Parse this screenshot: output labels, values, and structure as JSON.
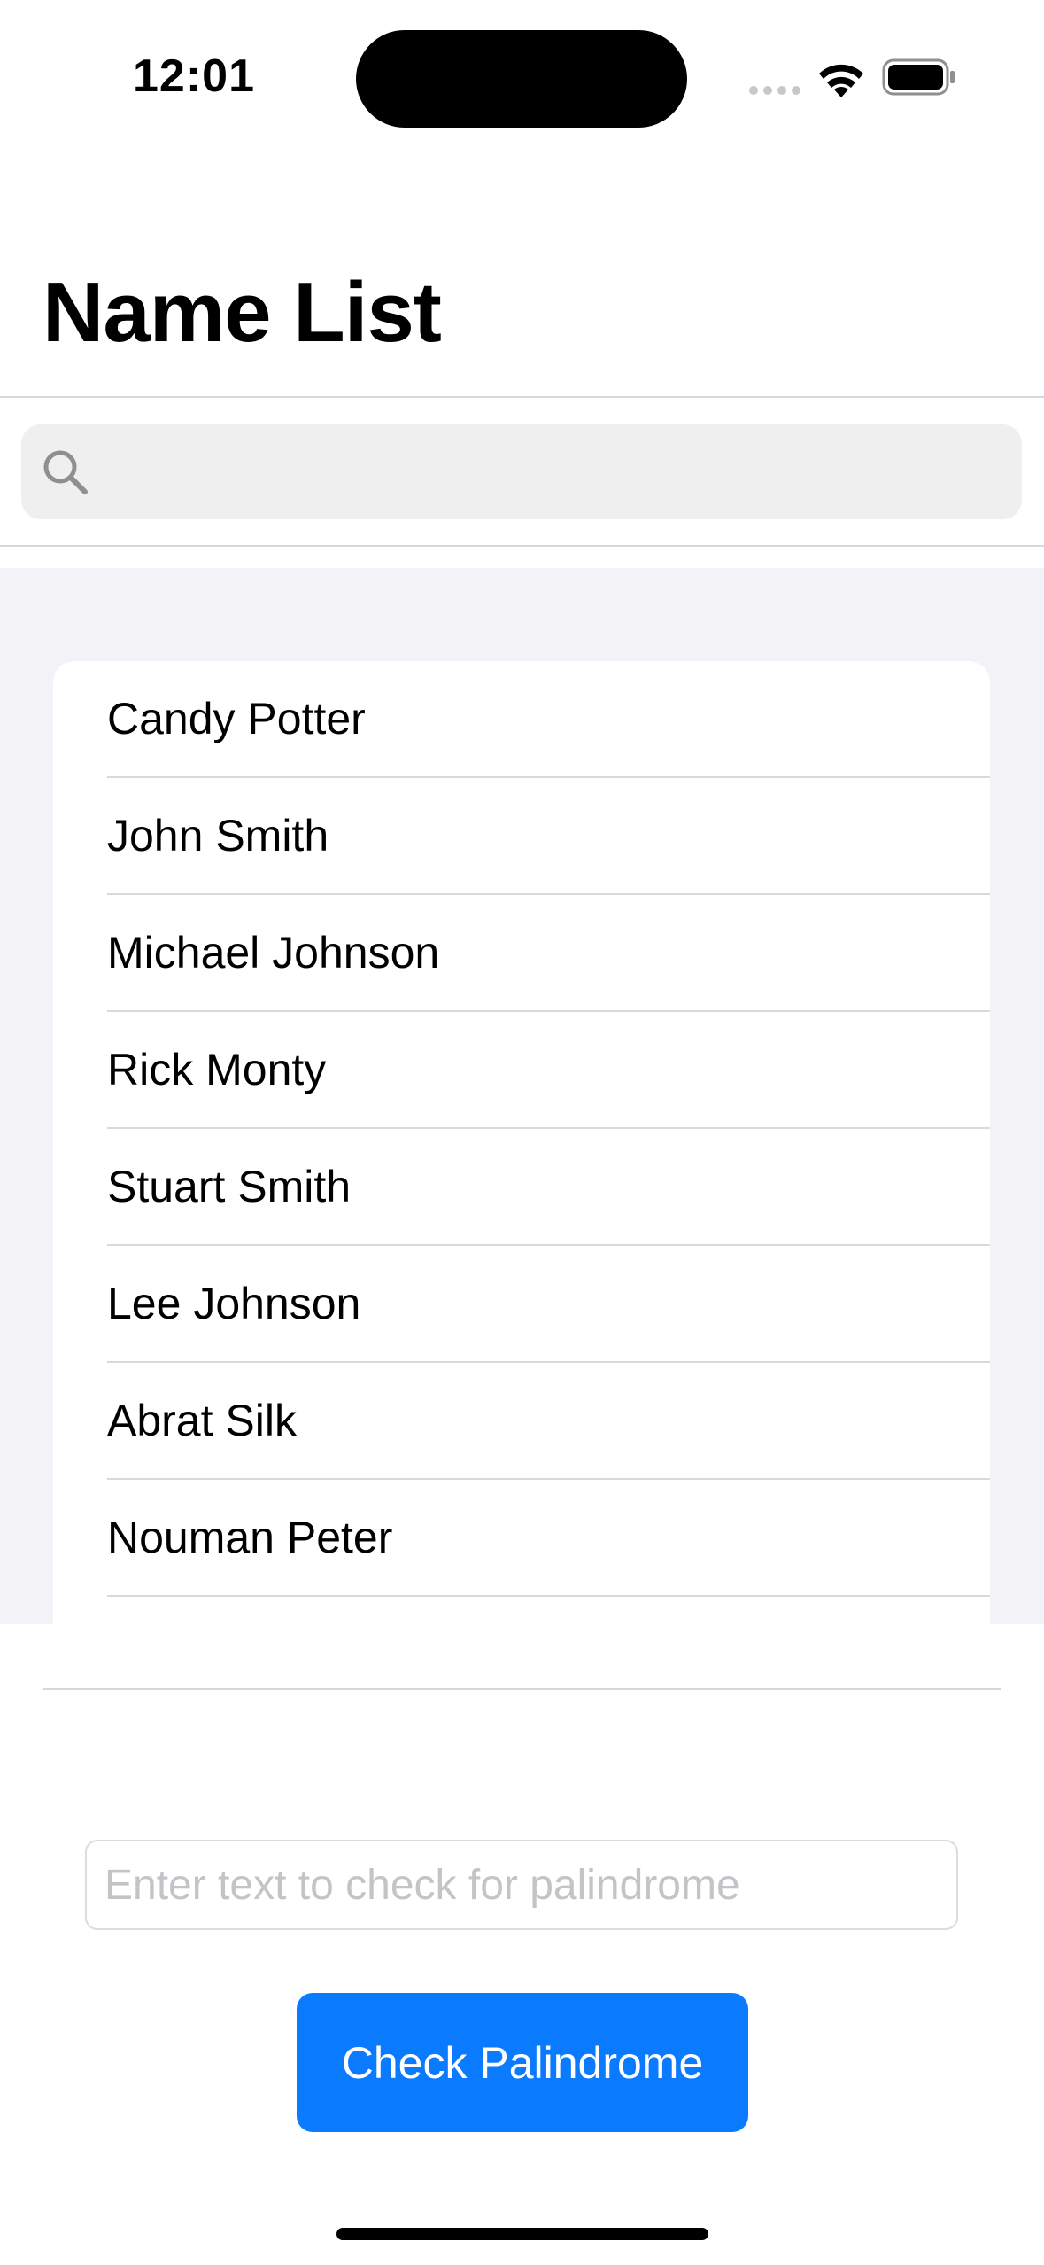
{
  "status_bar": {
    "time": "12:01",
    "icons": [
      "cellular-signal-icon",
      "wifi-icon",
      "battery-icon"
    ]
  },
  "header": {
    "title": "Name List"
  },
  "search": {
    "placeholder": "",
    "value": "",
    "icon": "search-icon"
  },
  "names": [
    "Candy Potter",
    "John Smith",
    "Michael Johnson",
    "Rick Monty",
    "Stuart Smith",
    "Lee Johnson",
    "Abrat Silk",
    "Nouman Peter"
  ],
  "palindrome": {
    "placeholder": "Enter text to check for palindrome",
    "value": "",
    "button_label": "Check Palindrome"
  },
  "colors": {
    "accent": "#0a7aff",
    "list_background": "#f2f2f7",
    "search_background": "#efeff0"
  }
}
